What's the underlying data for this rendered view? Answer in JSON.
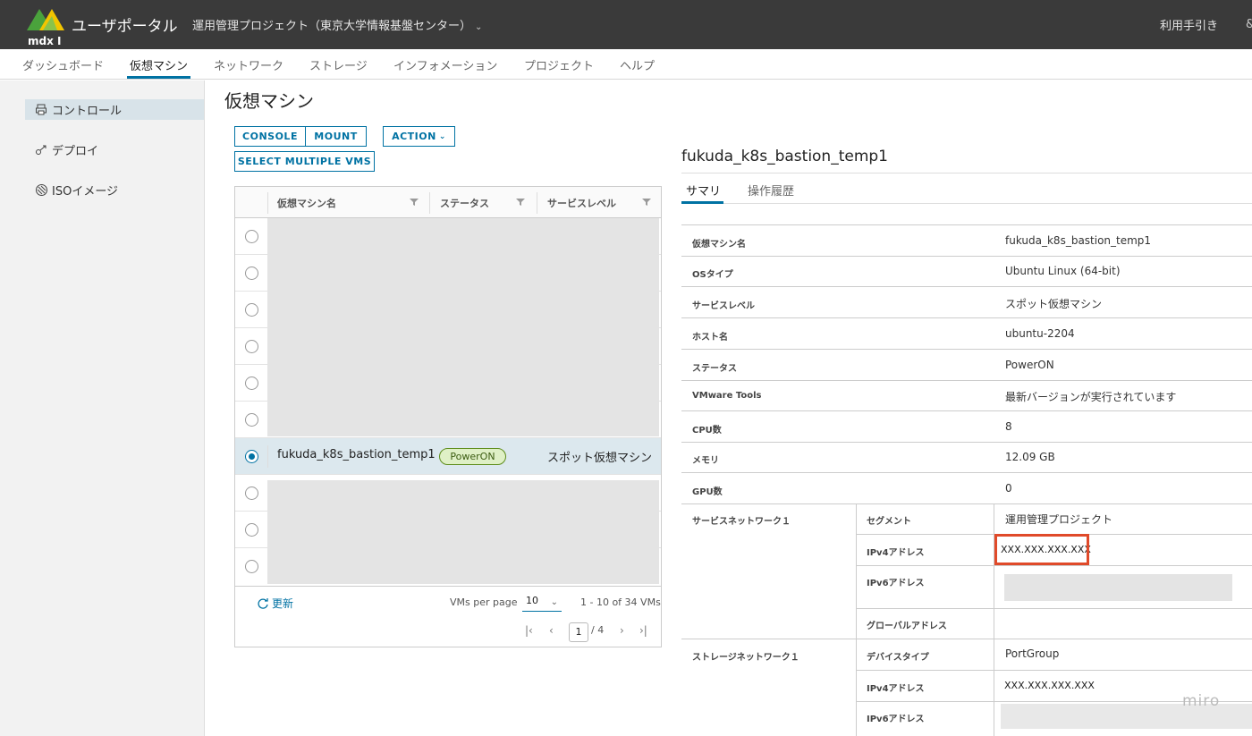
{
  "header": {
    "logo_text": "mdx Ⅰ",
    "app_title": "ユーザポータル",
    "project": "運用管理プロジェクト（東京大学情報基盤センター）",
    "help": "利用手引き"
  },
  "nav": [
    "ダッシュボード",
    "仮想マシン",
    "ネットワーク",
    "ストレージ",
    "インフォメーション",
    "プロジェクト",
    "ヘルプ"
  ],
  "sidebar": [
    {
      "label": "コントロール",
      "icon": "printer-icon"
    },
    {
      "label": "デプロイ",
      "icon": "share-icon"
    },
    {
      "label": "ISOイメージ",
      "icon": "disc-icon"
    }
  ],
  "page_title": "仮想マシン",
  "buttons": {
    "console": "CONSOLE",
    "mount": "MOUNT",
    "action": "ACTION",
    "select_multiple": "SELECT MULTIPLE VMS"
  },
  "grid": {
    "columns": [
      "仮想マシン名",
      "ステータス",
      "サービスレベル"
    ],
    "selected_row": {
      "name": "fukuda_k8s_bastion_temp1",
      "status": "PowerON",
      "service_level": "スポット仮想マシン"
    },
    "refresh": "更新",
    "per_page_label": "VMs per page",
    "per_page": "10",
    "range": "1 - 10 of 34 VMs",
    "page": "1",
    "total_pages": "/ 4"
  },
  "detail": {
    "title": "fukuda_k8s_bastion_temp1",
    "tabs": [
      "サマリ",
      "操作履歴"
    ],
    "rows": [
      {
        "label": "仮想マシン名",
        "value": "fukuda_k8s_bastion_temp1"
      },
      {
        "label": "OSタイプ",
        "value": "Ubuntu Linux (64-bit)"
      },
      {
        "label": "サービスレベル",
        "value": "スポット仮想マシン"
      },
      {
        "label": "ホスト名",
        "value": "ubuntu-2204"
      },
      {
        "label": "ステータス",
        "value": "PowerON"
      },
      {
        "label": "VMware Tools",
        "value": "最新バージョンが実行されています"
      },
      {
        "label": "CPU数",
        "value": "8"
      },
      {
        "label": "メモリ",
        "value": "12.09 GB"
      },
      {
        "label": "GPU数",
        "value": "0"
      }
    ],
    "service_network": {
      "label": "サービスネットワーク１",
      "segment_label": "セグメント",
      "segment": "運用管理プロジェクト",
      "ipv4_label": "IPv4アドレス",
      "ipv4": "XXX.XXX.XXX.XXX",
      "ipv6_label": "IPv6アドレス",
      "global_label": "グローバルアドレス"
    },
    "storage_network": {
      "label": "ストレージネットワーク１",
      "device_label": "デバイスタイプ",
      "device": "PortGroup",
      "ipv4_label": "IPv4アドレス",
      "ipv4": "XXX.XXX.XXX.XXX",
      "ipv6_label": "IPv6アドレス"
    }
  },
  "watermark": "miro"
}
